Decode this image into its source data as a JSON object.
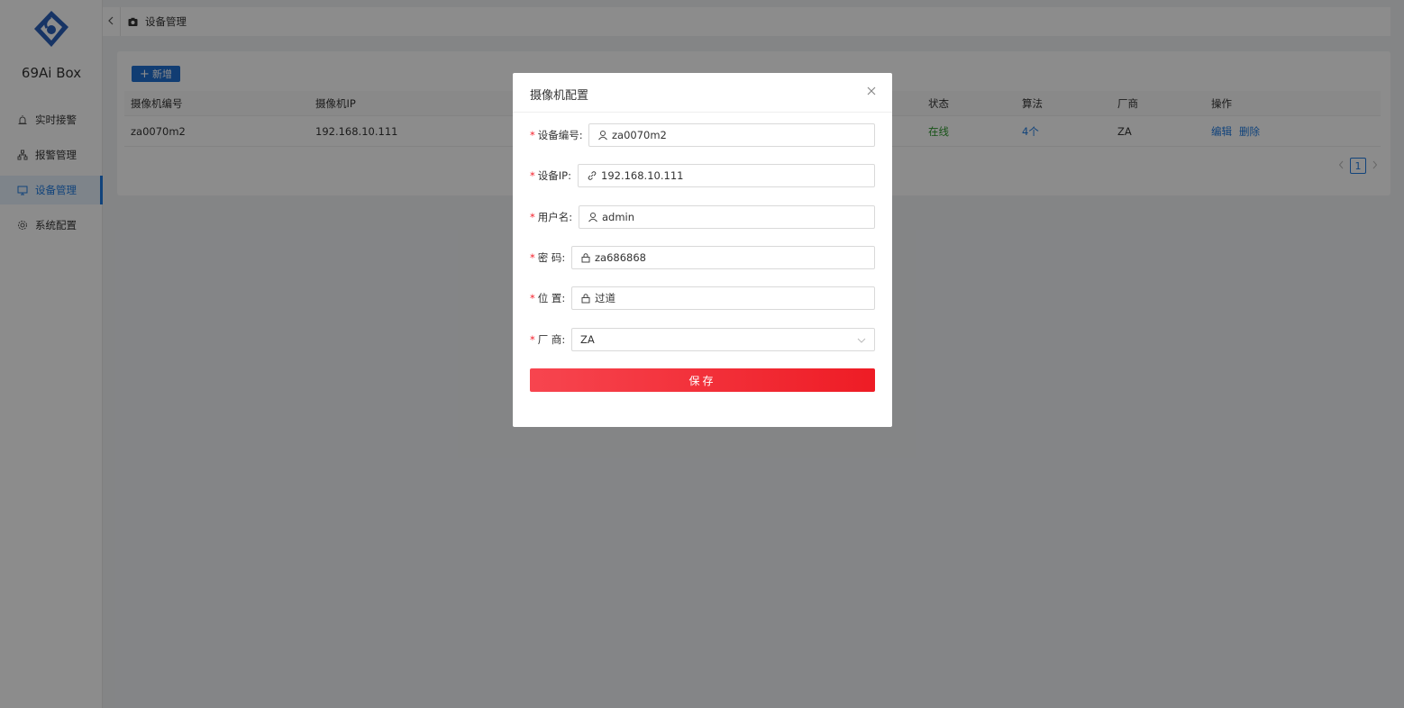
{
  "app": {
    "brand": "69Ai Box"
  },
  "sidebar": {
    "items": [
      {
        "label": "实时接警",
        "icon": "alarm-light-icon"
      },
      {
        "label": "报警管理",
        "icon": "sitemap-icon"
      },
      {
        "label": "设备管理",
        "icon": "monitor-icon",
        "active": true
      },
      {
        "label": "系统配置",
        "icon": "gear-icon"
      }
    ]
  },
  "header": {
    "breadcrumb": "设备管理",
    "icon": "camera-icon"
  },
  "toolbar": {
    "add_label": "新增"
  },
  "table": {
    "columns": [
      "摄像机编号",
      "摄像机IP",
      "状态",
      "算法",
      "厂商",
      "操作"
    ],
    "rows": [
      {
        "id": "za0070m2",
        "ip": "192.168.10.111",
        "status": "在线",
        "algo": "4个",
        "vendor": "ZA",
        "edit": "编辑",
        "delete": "删除"
      }
    ]
  },
  "pagination": {
    "current": "1"
  },
  "modal": {
    "title": "摄像机配置",
    "fields": {
      "device_id": {
        "label": "设备编号:",
        "value": "za0070m2",
        "icon": "user-icon"
      },
      "device_ip": {
        "label": "设备IP:",
        "value": "192.168.10.111",
        "icon": "link-icon"
      },
      "username": {
        "label": "用户名:",
        "value": "admin",
        "icon": "user-icon"
      },
      "password": {
        "label": "密 码:",
        "value": "za686868",
        "icon": "lock-icon"
      },
      "location": {
        "label": "位 置:",
        "value": "过道",
        "icon": "lock-icon"
      },
      "vendor": {
        "label": "厂 商:",
        "value": "ZA",
        "icon": "chevron-down-icon"
      }
    },
    "save_label": "保存"
  },
  "colors": {
    "primary": "#1f7ae0",
    "danger": "#ee1c25",
    "online": "#2e9a2e"
  }
}
